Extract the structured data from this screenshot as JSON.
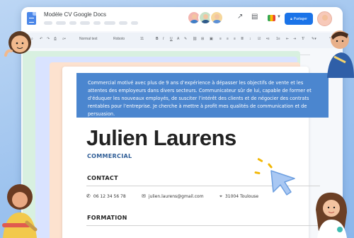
{
  "app": {
    "doc_title": "Modèle CV Google Docs",
    "share_label": "Partager",
    "icons": [
      "docs-icon",
      "trend-icon",
      "comment-icon",
      "meet-icon",
      "lock-icon"
    ]
  },
  "toolbar": {
    "zoom": "",
    "style": "Normal text",
    "font": "Roboto",
    "size": "11"
  },
  "resume": {
    "summary": "Commercial motivé avec plus de 9 ans d’expérience à dépasser les objectifs de vente et les attentes des employeurs dans divers secteurs. Communicateur sûr de lui, capable de former et d’éduquer les nouveaux employés, de susciter l’intérêt des clients et de négocier des contrats rentables pour l’entreprise. Je cherche à mettre à profit mes qualités de communication et de persuasion.",
    "name": "Julien Laurens",
    "role": "COMMERCIAL",
    "contact_title": "CONTACT",
    "phone": "06 12 34 56 78",
    "email": "julien.laurens@gmail.com",
    "location": "31004 Toulouse",
    "formation_title": "FORMATION"
  },
  "colors": {
    "banner": "#4b86cf",
    "share": "#1a73e8",
    "role": "#2f5d96",
    "paper_green": "#d8f0e0",
    "paper_blue": "#d9e3ff",
    "paper_peach": "#fde2cf"
  }
}
